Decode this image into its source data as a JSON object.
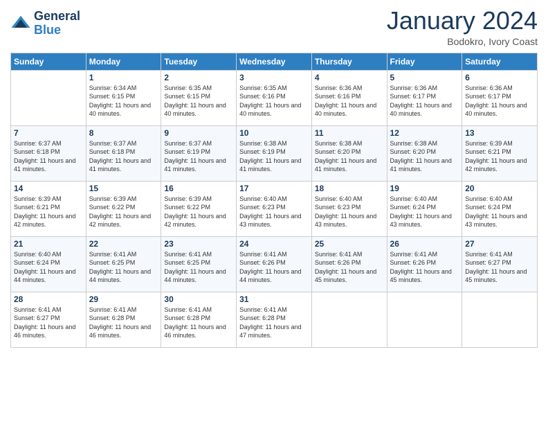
{
  "logo": {
    "text_general": "General",
    "text_blue": "Blue"
  },
  "header": {
    "month": "January 2024",
    "location": "Bodokro, Ivory Coast"
  },
  "weekdays": [
    "Sunday",
    "Monday",
    "Tuesday",
    "Wednesday",
    "Thursday",
    "Friday",
    "Saturday"
  ],
  "weeks": [
    [
      {
        "day": "",
        "sunrise": "",
        "sunset": "",
        "daylight": ""
      },
      {
        "day": "1",
        "sunrise": "Sunrise: 6:34 AM",
        "sunset": "Sunset: 6:15 PM",
        "daylight": "Daylight: 11 hours and 40 minutes."
      },
      {
        "day": "2",
        "sunrise": "Sunrise: 6:35 AM",
        "sunset": "Sunset: 6:15 PM",
        "daylight": "Daylight: 11 hours and 40 minutes."
      },
      {
        "day": "3",
        "sunrise": "Sunrise: 6:35 AM",
        "sunset": "Sunset: 6:16 PM",
        "daylight": "Daylight: 11 hours and 40 minutes."
      },
      {
        "day": "4",
        "sunrise": "Sunrise: 6:36 AM",
        "sunset": "Sunset: 6:16 PM",
        "daylight": "Daylight: 11 hours and 40 minutes."
      },
      {
        "day": "5",
        "sunrise": "Sunrise: 6:36 AM",
        "sunset": "Sunset: 6:17 PM",
        "daylight": "Daylight: 11 hours and 40 minutes."
      },
      {
        "day": "6",
        "sunrise": "Sunrise: 6:36 AM",
        "sunset": "Sunset: 6:17 PM",
        "daylight": "Daylight: 11 hours and 40 minutes."
      }
    ],
    [
      {
        "day": "7",
        "sunrise": "Sunrise: 6:37 AM",
        "sunset": "Sunset: 6:18 PM",
        "daylight": "Daylight: 11 hours and 41 minutes."
      },
      {
        "day": "8",
        "sunrise": "Sunrise: 6:37 AM",
        "sunset": "Sunset: 6:18 PM",
        "daylight": "Daylight: 11 hours and 41 minutes."
      },
      {
        "day": "9",
        "sunrise": "Sunrise: 6:37 AM",
        "sunset": "Sunset: 6:19 PM",
        "daylight": "Daylight: 11 hours and 41 minutes."
      },
      {
        "day": "10",
        "sunrise": "Sunrise: 6:38 AM",
        "sunset": "Sunset: 6:19 PM",
        "daylight": "Daylight: 11 hours and 41 minutes."
      },
      {
        "day": "11",
        "sunrise": "Sunrise: 6:38 AM",
        "sunset": "Sunset: 6:20 PM",
        "daylight": "Daylight: 11 hours and 41 minutes."
      },
      {
        "day": "12",
        "sunrise": "Sunrise: 6:38 AM",
        "sunset": "Sunset: 6:20 PM",
        "daylight": "Daylight: 11 hours and 41 minutes."
      },
      {
        "day": "13",
        "sunrise": "Sunrise: 6:39 AM",
        "sunset": "Sunset: 6:21 PM",
        "daylight": "Daylight: 11 hours and 42 minutes."
      }
    ],
    [
      {
        "day": "14",
        "sunrise": "Sunrise: 6:39 AM",
        "sunset": "Sunset: 6:21 PM",
        "daylight": "Daylight: 11 hours and 42 minutes."
      },
      {
        "day": "15",
        "sunrise": "Sunrise: 6:39 AM",
        "sunset": "Sunset: 6:22 PM",
        "daylight": "Daylight: 11 hours and 42 minutes."
      },
      {
        "day": "16",
        "sunrise": "Sunrise: 6:39 AM",
        "sunset": "Sunset: 6:22 PM",
        "daylight": "Daylight: 11 hours and 42 minutes."
      },
      {
        "day": "17",
        "sunrise": "Sunrise: 6:40 AM",
        "sunset": "Sunset: 6:23 PM",
        "daylight": "Daylight: 11 hours and 43 minutes."
      },
      {
        "day": "18",
        "sunrise": "Sunrise: 6:40 AM",
        "sunset": "Sunset: 6:23 PM",
        "daylight": "Daylight: 11 hours and 43 minutes."
      },
      {
        "day": "19",
        "sunrise": "Sunrise: 6:40 AM",
        "sunset": "Sunset: 6:24 PM",
        "daylight": "Daylight: 11 hours and 43 minutes."
      },
      {
        "day": "20",
        "sunrise": "Sunrise: 6:40 AM",
        "sunset": "Sunset: 6:24 PM",
        "daylight": "Daylight: 11 hours and 43 minutes."
      }
    ],
    [
      {
        "day": "21",
        "sunrise": "Sunrise: 6:40 AM",
        "sunset": "Sunset: 6:24 PM",
        "daylight": "Daylight: 11 hours and 44 minutes."
      },
      {
        "day": "22",
        "sunrise": "Sunrise: 6:41 AM",
        "sunset": "Sunset: 6:25 PM",
        "daylight": "Daylight: 11 hours and 44 minutes."
      },
      {
        "day": "23",
        "sunrise": "Sunrise: 6:41 AM",
        "sunset": "Sunset: 6:25 PM",
        "daylight": "Daylight: 11 hours and 44 minutes."
      },
      {
        "day": "24",
        "sunrise": "Sunrise: 6:41 AM",
        "sunset": "Sunset: 6:26 PM",
        "daylight": "Daylight: 11 hours and 44 minutes."
      },
      {
        "day": "25",
        "sunrise": "Sunrise: 6:41 AM",
        "sunset": "Sunset: 6:26 PM",
        "daylight": "Daylight: 11 hours and 45 minutes."
      },
      {
        "day": "26",
        "sunrise": "Sunrise: 6:41 AM",
        "sunset": "Sunset: 6:26 PM",
        "daylight": "Daylight: 11 hours and 45 minutes."
      },
      {
        "day": "27",
        "sunrise": "Sunrise: 6:41 AM",
        "sunset": "Sunset: 6:27 PM",
        "daylight": "Daylight: 11 hours and 45 minutes."
      }
    ],
    [
      {
        "day": "28",
        "sunrise": "Sunrise: 6:41 AM",
        "sunset": "Sunset: 6:27 PM",
        "daylight": "Daylight: 11 hours and 46 minutes."
      },
      {
        "day": "29",
        "sunrise": "Sunrise: 6:41 AM",
        "sunset": "Sunset: 6:28 PM",
        "daylight": "Daylight: 11 hours and 46 minutes."
      },
      {
        "day": "30",
        "sunrise": "Sunrise: 6:41 AM",
        "sunset": "Sunset: 6:28 PM",
        "daylight": "Daylight: 11 hours and 46 minutes."
      },
      {
        "day": "31",
        "sunrise": "Sunrise: 6:41 AM",
        "sunset": "Sunset: 6:28 PM",
        "daylight": "Daylight: 11 hours and 47 minutes."
      },
      {
        "day": "",
        "sunrise": "",
        "sunset": "",
        "daylight": ""
      },
      {
        "day": "",
        "sunrise": "",
        "sunset": "",
        "daylight": ""
      },
      {
        "day": "",
        "sunrise": "",
        "sunset": "",
        "daylight": ""
      }
    ]
  ]
}
